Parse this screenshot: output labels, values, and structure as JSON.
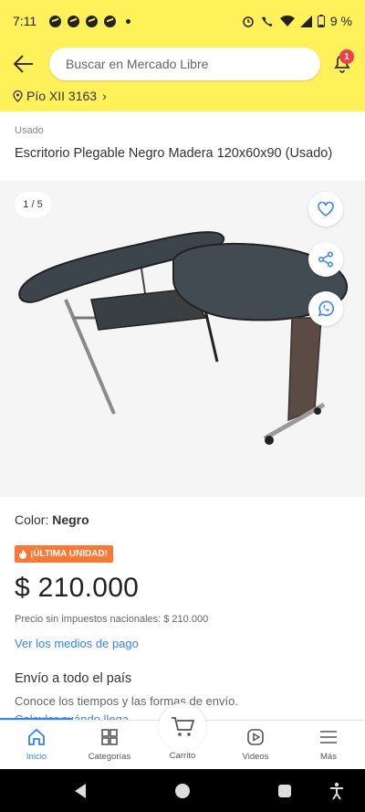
{
  "status_bar": {
    "time": "7:11",
    "battery": "9 %"
  },
  "header": {
    "search_placeholder": "Buscar en Mercado Libre",
    "notification_count": "1",
    "address": "Pío XII 3163"
  },
  "product": {
    "condition": "Usado",
    "title": "Escritorio Plegable Negro Madera 120x60x90 (Usado)",
    "gallery_pager": "1 / 5",
    "color_label": "Color: ",
    "color_value": "Negro",
    "badge": "¡ÚLTIMA UNIDAD!",
    "price": "$ 210.000",
    "tax_note": "Precio sin impuestos nacionales: $ 210.000",
    "payment_link": "Ver los medios de pago"
  },
  "shipping": {
    "title": "Envío a todo el país",
    "subtitle": "Conoce los tiempos y las formas de envío.",
    "link": "Calcular cuándo llega"
  },
  "bottom_nav": {
    "items": [
      {
        "label": "Inicio"
      },
      {
        "label": "Categorías"
      },
      {
        "label": "Carrito"
      },
      {
        "label": "Videos"
      },
      {
        "label": "Más"
      }
    ]
  },
  "colors": {
    "header_yellow": "#fff159",
    "link_blue": "#3483fa",
    "badge_orange": "#ff7733",
    "notif_red": "#f23d4f"
  }
}
